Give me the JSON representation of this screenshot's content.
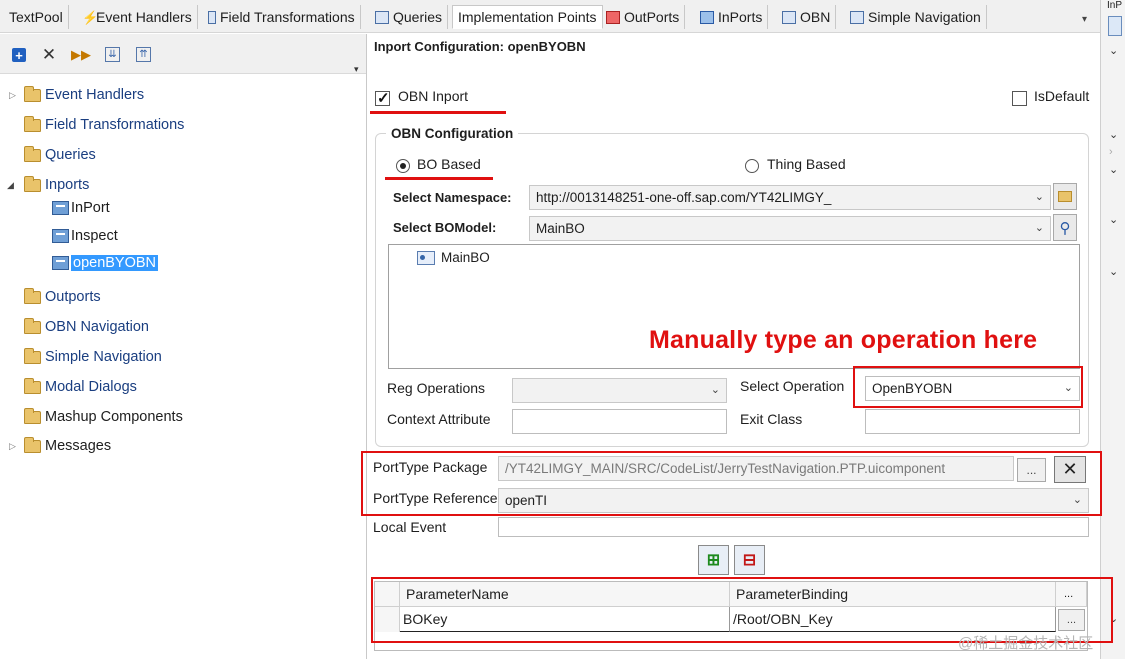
{
  "tabs": [
    {
      "label": "TextPool",
      "icon": ""
    },
    {
      "label": "Event Handlers",
      "icon": "lightning-icon"
    },
    {
      "label": "Field Transformations",
      "icon": "transform-icon"
    },
    {
      "label": "Queries",
      "icon": "query-icon"
    },
    {
      "label": "Implementation Points",
      "icon": ""
    },
    {
      "label": "OutPorts",
      "icon": "outport-icon"
    },
    {
      "label": "InPorts",
      "icon": "inport-icon"
    },
    {
      "label": "OBN",
      "icon": "obn-icon"
    },
    {
      "label": "Simple Navigation",
      "icon": "navigation-icon"
    }
  ],
  "right_strip": {
    "label": "InP"
  },
  "tree": {
    "items": [
      {
        "label": "Event Handlers"
      },
      {
        "label": "Field Transformations"
      },
      {
        "label": "Queries"
      },
      {
        "label": "Inports"
      },
      {
        "label": "InPort"
      },
      {
        "label": "Inspect"
      },
      {
        "label": "openBYOBN"
      },
      {
        "label": "Outports"
      },
      {
        "label": "OBN Navigation"
      },
      {
        "label": "Simple Navigation"
      },
      {
        "label": "Modal Dialogs"
      },
      {
        "label": "Mashup Components"
      },
      {
        "label": "Messages"
      }
    ]
  },
  "inport_config": {
    "title": "Inport Configuration: openBYOBN",
    "obn_inport_label": "OBN Inport",
    "obn_inport_checked": true,
    "is_default_label": "IsDefault",
    "is_default_checked": false
  },
  "obn_config": {
    "group_title": "OBN Configuration",
    "bo_based_label": "BO Based",
    "thing_based_label": "Thing Based",
    "selected_mode": "BO Based",
    "namespace_label": "Select Namespace:",
    "namespace_value": "http://0013148251-one-off.sap.com/YT42LIMGY_",
    "bomodel_label": "Select BOModel:",
    "bomodel_value": "MainBO",
    "bo_tree_item": "MainBO",
    "reg_operations_label": "Reg Operations",
    "reg_operations_value": "",
    "select_operation_label": "Select Operation",
    "select_operation_value": "OpenBYOBN",
    "context_attribute_label": "Context Attribute",
    "context_attribute_value": "",
    "exit_class_label": "Exit Class",
    "exit_class_value": ""
  },
  "annotation": "Manually type an operation here",
  "porttype": {
    "package_label": "PortType Package",
    "package_value": "/YT42LIMGY_MAIN/SRC/CodeList/JerryTestNavigation.PTP.uicomponent",
    "browse_label": "...",
    "reference_label": "PortType Reference",
    "reference_value": "openTI",
    "local_event_label": "Local Event",
    "local_event_value": ""
  },
  "parameters": {
    "columns": [
      "ParameterName",
      "ParameterBinding",
      "..."
    ],
    "rows": [
      {
        "name": "BOKey",
        "binding": "/Root/OBN_Key",
        "action": "..."
      }
    ]
  },
  "watermark": "@稀土掘金技术社区",
  "colors": {
    "annotation_red": "#e01010",
    "selection_blue": "#3399ff",
    "tree_text": "#1a3e80"
  }
}
